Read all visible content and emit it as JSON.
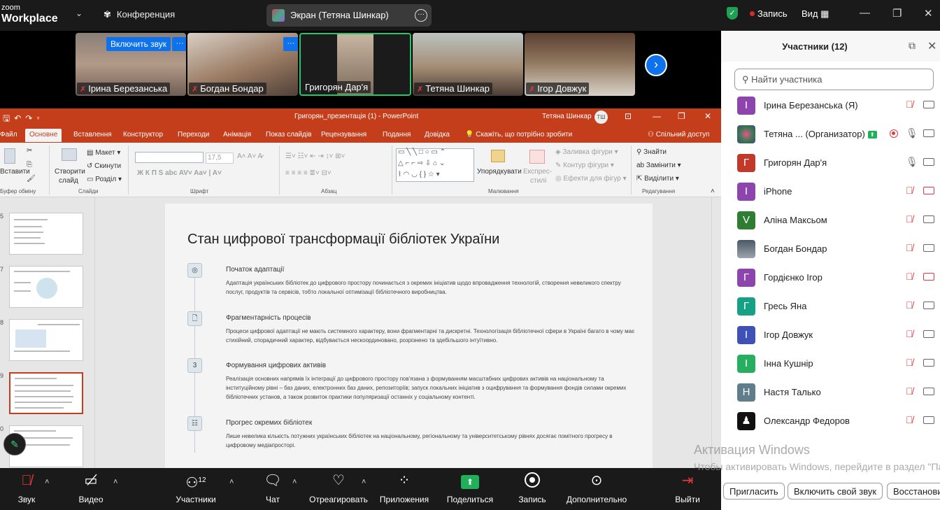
{
  "app": {
    "logo_top": "zoom",
    "logo_bottom": "Workplace"
  },
  "topbar": {
    "meeting_label": "Конференция",
    "screen_label": "Экран (Тетяна Шинкар)",
    "record_label": "Запись",
    "view_label": "Вид"
  },
  "video": {
    "unmute_label": "Включить звук",
    "tiles": [
      {
        "name": "Ірина Березанська"
      },
      {
        "name": "Богдан Бондар"
      },
      {
        "name": "Григорян Дар'я"
      },
      {
        "name": "Тетяна Шинкар"
      },
      {
        "name": "Ігор Довжук"
      }
    ]
  },
  "ppt": {
    "filename": "Григорян_презентація (1)  -  PowerPoint",
    "user": "Тетяна Шинкар",
    "user_initials": "ТШ",
    "tabs": [
      "Файл",
      "Основне",
      "Вставлення",
      "Конструктор",
      "Переходи",
      "Анімація",
      "Показ слайдів",
      "Рецензування",
      "Подання",
      "Довідка",
      "Скажіть, що потрібно зробити",
      "Спільний доступ"
    ],
    "ribbon": {
      "paste": "Вставити",
      "clipboard_group": "Буфер обміну",
      "new_slide_1": "Створити",
      "new_slide_2": "слайд",
      "layout": "Макет",
      "reset": "Скинути",
      "section": "Розділ",
      "slides_group": "Слайди",
      "font_group": "Шрифт",
      "paragraph_group": "Абзац",
      "arrange": "Упорядкувати",
      "quick_styles_1": "Експрес-",
      "quick_styles_2": "стилі",
      "shape_fill": "Заливка фігури",
      "shape_outline": "Контур фігури",
      "shape_effects": "Ефекти для фігур",
      "drawing_group": "Малювання",
      "find": "Знайти",
      "replace": "Замінити",
      "select": "Виділити",
      "editing_group": "Редагування",
      "font_size": "17,5"
    },
    "thumb_numbers": [
      "5",
      "7",
      "8",
      "9",
      "0"
    ],
    "slide": {
      "title": "Стан цифрової трансформації бібліотек України",
      "items": [
        {
          "heading": "Початок адаптації",
          "text": "Адаптація українських бібліотек до цифрового простору починається з окремих ініціатив щодо впровадження технологій, створення невеликого спектру послуг, продуктів та сервісів, тобто локальної оптимізації бібліотечного виробництва."
        },
        {
          "heading": "Фрагментарність процесів",
          "text": "Процеси цифрової адаптації не мають системного характеру, вони фрагментарні та дискретні. Технологізація бібліотечної сфери в Україні багато в чому має стихійний, спорадичний характер, відбувається нескоординовано, розрізнено та здебільшого інтуїтивно."
        },
        {
          "heading": "Формування цифрових активів",
          "text": "Реалізація основних напрямів їх інтеграції до цифрового простору пов'язана з формуванням масштабних цифрових активів на національному та інституційному рівні – баз даних, електронних баз даних, репозиторіїв; запуск локальних ініціатив з оцифрування та формування фондів силами окремих бібліотечних установ, а також розвиток практики популяризації останніх у соціальному контенті."
        },
        {
          "heading": "Прогрес окремих бібліотек",
          "text": "Лише невелика кількість потужних українських бібліотек на національному, регіональному та університетському рівнях досягає помітного прогресу в цифровому медіапросторі."
        }
      ],
      "step_number": "3"
    }
  },
  "bottom": {
    "audio": "Звук",
    "video": "Видео",
    "participants": "Участники",
    "participants_count": "12",
    "chat": "Чат",
    "react": "Отреагировать",
    "apps": "Приложения",
    "share": "Поделиться",
    "record": "Запись",
    "more": "Дополнительно",
    "leave": "Выйти"
  },
  "panel": {
    "title": "Участники (12)",
    "search_placeholder": "Найти участника",
    "participants": [
      {
        "initial": "І",
        "name": "Ірина Березанська (Я)",
        "color": "#8e44ad"
      },
      {
        "initial": "",
        "name": "Тетяна ...  (Организатор)",
        "color": "#2c7a4d"
      },
      {
        "initial": "Г",
        "name": "Григорян Дар'я",
        "color": "#c0392b"
      },
      {
        "initial": "I",
        "name": "iPhone",
        "color": "#8e44ad"
      },
      {
        "initial": "V",
        "name": "Аліна Максьом",
        "color": "#2e7d32"
      },
      {
        "initial": "",
        "name": "Богдан Бондар",
        "color": "#6b7480"
      },
      {
        "initial": "Г",
        "name": "Гордієнко Ігор",
        "color": "#8e44ad"
      },
      {
        "initial": "Г",
        "name": "Гресь Яна",
        "color": "#16a085"
      },
      {
        "initial": "І",
        "name": "Ігор Довжук",
        "color": "#3f51b5"
      },
      {
        "initial": "І",
        "name": "Інна Кушнір",
        "color": "#27ae60"
      },
      {
        "initial": "Н",
        "name": "Настя Талько",
        "color": "#607d8b"
      },
      {
        "initial": "",
        "name": "Олександр Федоров",
        "color": "#111111"
      }
    ],
    "invite": "Пригласить",
    "unmute_self": "Включить свой звук",
    "restore": "Восстанови"
  },
  "windows_activation": {
    "title": "Активация Windows",
    "text": "Чтобы активировать Windows, перейдите в раздел \"Параметры\"."
  }
}
